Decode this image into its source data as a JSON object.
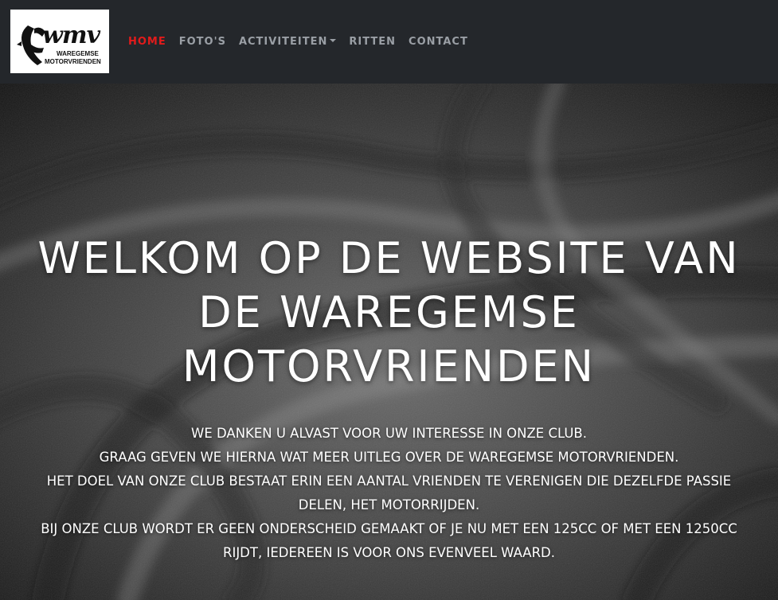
{
  "logo": {
    "title": "wmv",
    "line1": "WAREGEMSE",
    "line2": "MOTORVRIENDEN"
  },
  "nav": {
    "items": [
      {
        "label": "HOME",
        "active": true
      },
      {
        "label": "FOTO'S",
        "active": false
      },
      {
        "label": "ACTIVITEITEN",
        "active": false,
        "dropdown": true
      },
      {
        "label": "RITTEN",
        "active": false
      },
      {
        "label": "CONTACT",
        "active": false
      }
    ]
  },
  "hero": {
    "title_lines": [
      "WELKOM OP DE WEBSITE VAN",
      "DE WAREGEMSE",
      "MOTORVRIENDEN"
    ],
    "text_lines": [
      "WE DANKEN U ALVAST VOOR UW INTERESSE IN ONZE CLUB.",
      "GRAAG GEVEN WE HIERNA WAT MEER UITLEG OVER DE WAREGEMSE MOTORVRIENDEN.",
      "HET DOEL VAN ONZE CLUB BESTAAT ERIN EEN AANTAL VRIENDEN TE VERENIGEN DIE DEZELFDE PASSIE",
      "DELEN, HET MOTORRIJDEN.",
      "BIJ ONZE CLUB WORDT ER GEEN ONDERSCHEID GEMAAKT OF JE NU MET EEN 125CC OF MET EEN 1250CC",
      "RIJDT, IEDEREEN IS VOOR ONS EVENVEEL WAARD."
    ]
  },
  "colors": {
    "navbar_bg": "#24272b",
    "nav_link": "#9a9fa5",
    "nav_active": "#e21b1b",
    "hero_text": "#ffffff"
  }
}
